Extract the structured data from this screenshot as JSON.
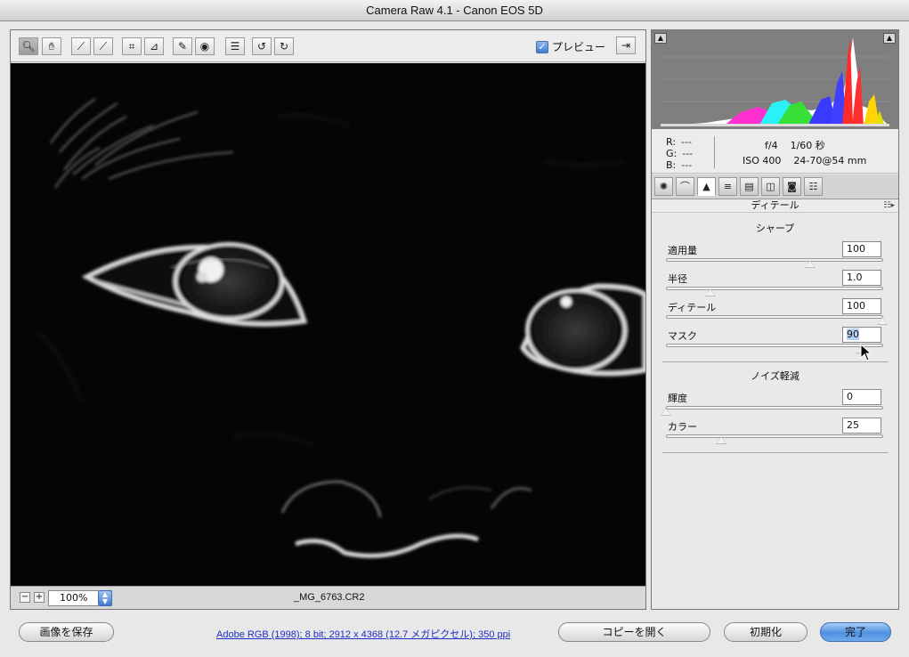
{
  "window": {
    "title": "Camera Raw 4.1  -  Canon EOS 5D"
  },
  "toolbar": {
    "tools": [
      {
        "name": "zoom-tool",
        "icon": "magnifier-icon"
      },
      {
        "name": "hand-tool",
        "icon": "hand-icon"
      },
      {
        "name": "white-balance-tool",
        "icon": "eyedropper-icon"
      },
      {
        "name": "color-sampler-tool",
        "icon": "color-sampler-icon"
      },
      {
        "name": "crop-tool",
        "icon": "crop-icon"
      },
      {
        "name": "straighten-tool",
        "icon": "straighten-icon"
      },
      {
        "name": "retouch-tool",
        "icon": "brush-icon"
      },
      {
        "name": "red-eye-tool",
        "icon": "red-eye-icon"
      },
      {
        "name": "preferences-tool",
        "icon": "list-icon"
      },
      {
        "name": "rotate-left-tool",
        "icon": "rotate-ccw-icon"
      },
      {
        "name": "rotate-right-tool",
        "icon": "rotate-cw-icon"
      }
    ],
    "preview_label": "プレビュー",
    "preview_checked": true
  },
  "status": {
    "zoom": "100%",
    "filename": "_MG_6763.CR2"
  },
  "info": {
    "r_label": "R:",
    "g_label": "G:",
    "b_label": "B:",
    "r": "---",
    "g": "---",
    "b": "---",
    "aperture": "f/4",
    "shutter": "1/60 秒",
    "iso": "ISO 400",
    "lens": "24-70@54 mm"
  },
  "panel": {
    "title": "ディテール",
    "sharpen": {
      "title": "シャープ",
      "sliders": [
        {
          "label": "適用量",
          "value": "100",
          "min": 0,
          "max": 150
        },
        {
          "label": "半径",
          "value": "1.0",
          "min": 0.5,
          "max": 3.0
        },
        {
          "label": "ディテール",
          "value": "100",
          "min": 0,
          "max": 100
        },
        {
          "label": "マスク",
          "value": "90",
          "min": 0,
          "max": 100
        }
      ]
    },
    "noise": {
      "title": "ノイズ軽減",
      "sliders": [
        {
          "label": "輝度",
          "value": "0",
          "min": 0,
          "max": 100
        },
        {
          "label": "カラー",
          "value": "25",
          "min": 0,
          "max": 100
        }
      ]
    }
  },
  "buttons": {
    "save": "画像を保存",
    "open_copy": "コピーを開く",
    "reset": "初期化",
    "done": "完了"
  },
  "workflow_link": "Adobe RGB (1998); 8 bit; 2912 x 4368 (12.7 メガピクセル); 350 ppi"
}
